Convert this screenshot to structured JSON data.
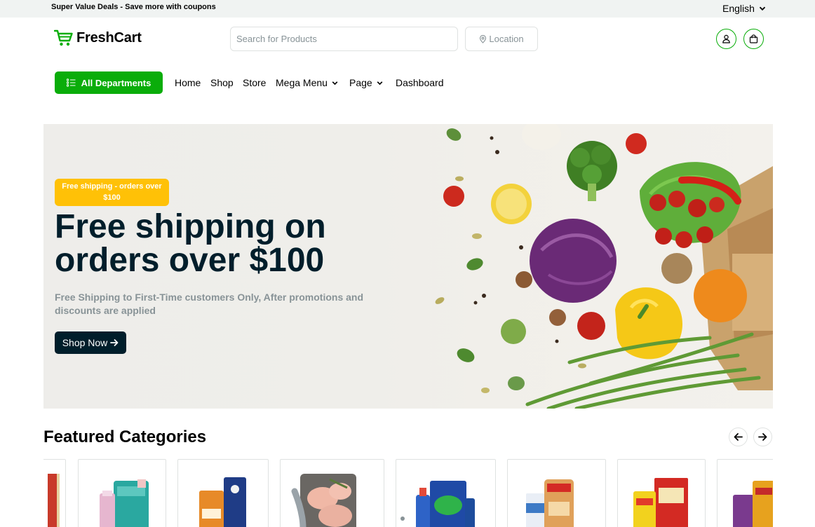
{
  "topbar": {
    "promo": "Super Value Deals - Save more with coupons",
    "language": "English"
  },
  "header": {
    "brand": "FreshCart",
    "search_placeholder": "Search for Products",
    "location_label": "Location"
  },
  "nav": {
    "departments_label": "All Departments",
    "items": [
      "Home",
      "Shop",
      "Store",
      "Mega Menu",
      "Page",
      "Dashboard"
    ]
  },
  "hero": {
    "badge": "Free shipping - orders over $100",
    "title": "Free shipping on orders over $100",
    "subtitle": "Free Shipping to First-Time customers Only, After promotions and discounts are applied",
    "cta": "Shop Now"
  },
  "featured": {
    "title": "Featured Categories",
    "categories": [
      {
        "icon": "snack-pack-icon"
      },
      {
        "icon": "baby-care-icon"
      },
      {
        "icon": "bakery-biscuits-icon"
      },
      {
        "icon": "meat-fish-icon"
      },
      {
        "icon": "cleaning-essentials-icon"
      },
      {
        "icon": "dairy-bread-icon"
      },
      {
        "icon": "instant-food-icon"
      },
      {
        "icon": "pet-care-icon"
      }
    ]
  },
  "colors": {
    "brand": "#0aad0a",
    "dark": "#001e2b",
    "badge": "#ffc107",
    "muted": "#889397"
  }
}
